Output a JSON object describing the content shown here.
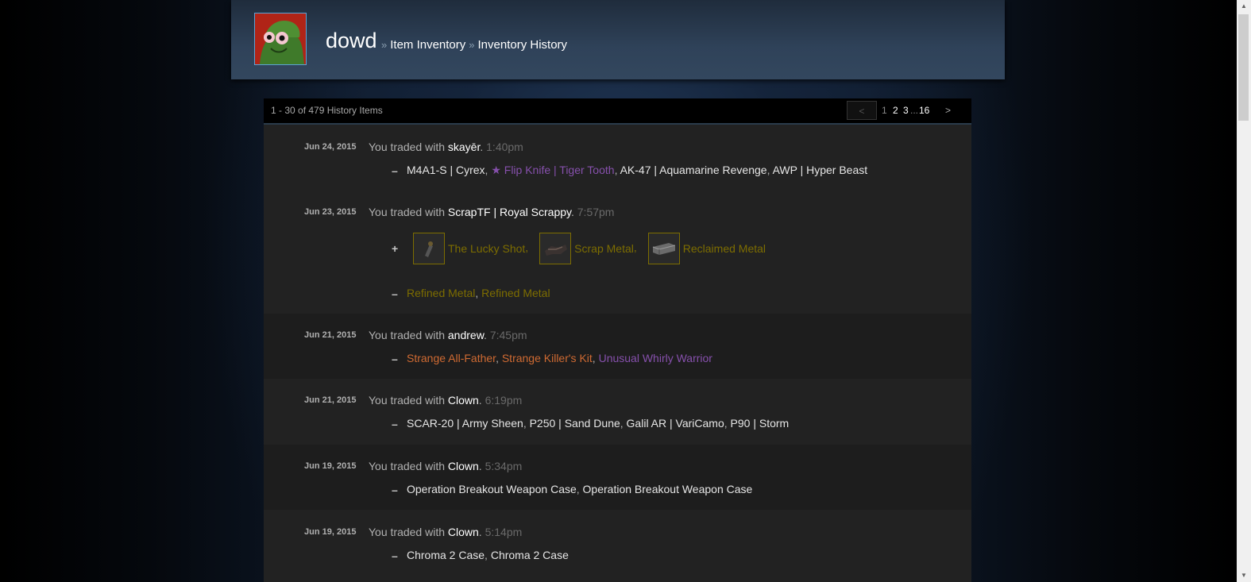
{
  "header": {
    "persona_name": "dowd",
    "separator": "»",
    "crumbs": [
      "Item Inventory",
      "Inventory History"
    ]
  },
  "panel": {
    "summary": "1 - 30 of 479 History Items",
    "pager": {
      "prev": "<",
      "pages": [
        "1",
        "2",
        "3",
        "...",
        "16"
      ],
      "next": ">"
    }
  },
  "trades": [
    {
      "date": "Jun 24, 2015",
      "prefix": "You traded with ",
      "partner": "skayēr",
      "time": "1:40pm",
      "minus": [
        "M4A1-S | Cyrex",
        "★ Flip Knife | Tiger Tooth",
        "AK-47 | Aquamarine Revenge",
        "AWP | Hyper Beast"
      ]
    },
    {
      "date": "Jun 23, 2015",
      "prefix": "You traded with ",
      "partner": "ScrapTF | Royal Scrappy",
      "time": "7:57pm",
      "plus": [
        "The Lucky Shot",
        "Scrap Metal",
        "Reclaimed Metal"
      ],
      "minus": [
        "Refined Metal",
        "Refined Metal"
      ]
    },
    {
      "date": "Jun 21, 2015",
      "prefix": "You traded with ",
      "partner": "andrew",
      "time": "7:45pm",
      "minus": [
        "Strange All-Father",
        "Strange Killer's Kit",
        "Unusual Whirly Warrior"
      ]
    },
    {
      "date": "Jun 21, 2015",
      "prefix": "You traded with ",
      "partner": "Clown",
      "time": "6:19pm",
      "minus": [
        "SCAR-20 | Army Sheen",
        "P250 | Sand Dune",
        "Galil AR | VariCamo",
        "P90 | Storm"
      ]
    },
    {
      "date": "Jun 19, 2015",
      "prefix": "You traded with ",
      "partner": "Clown",
      "time": "5:34pm",
      "minus": [
        "Operation Breakout Weapon Case",
        "Operation Breakout Weapon Case"
      ]
    },
    {
      "date": "Jun 19, 2015",
      "prefix": "You traded with ",
      "partner": "Clown",
      "time": "5:14pm",
      "minus": [
        "Chroma 2 Case",
        "Chroma 2 Case"
      ]
    }
  ],
  "signs": {
    "plus": "+",
    "minus": "–"
  },
  "punct": {
    "comma": ", ",
    "period": ". "
  },
  "colors": {
    "quality_unique_tf2": "#7d6d00",
    "quality_strange": "#cf6a32",
    "quality_unusual": "#8650ac",
    "rarity_knife": "#8650ac",
    "default_item": "#e6e6e6"
  }
}
